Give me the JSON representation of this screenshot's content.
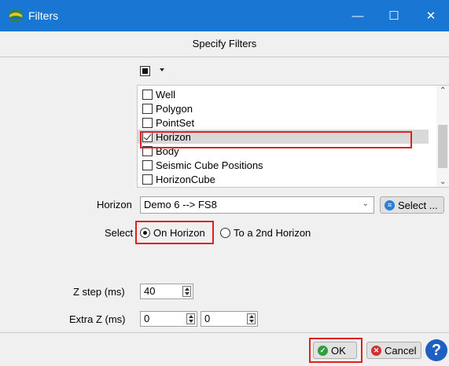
{
  "window": {
    "title": "Filters",
    "icon": "app-logo-icon",
    "controls": {
      "minimize": "—",
      "maximize": "☐",
      "close": "✕"
    }
  },
  "heading": "Specify Filters",
  "select_all": {
    "icon": "select-all-icon"
  },
  "filter_list": {
    "items": [
      {
        "label": "Well",
        "checked": false
      },
      {
        "label": "Polygon",
        "checked": false
      },
      {
        "label": "PointSet",
        "checked": false
      },
      {
        "label": "Horizon",
        "checked": true
      },
      {
        "label": "Body",
        "checked": false
      },
      {
        "label": "Seismic Cube Positions",
        "checked": false
      },
      {
        "label": "HorizonCube",
        "checked": false
      }
    ]
  },
  "horizon": {
    "label": "Horizon",
    "value": "Demo 6 --> FS8",
    "select_button": "Select ..."
  },
  "select_mode": {
    "label": "Select",
    "options": [
      {
        "label": "On Horizon",
        "selected": true
      },
      {
        "label": "To a 2nd Horizon",
        "selected": false
      }
    ]
  },
  "z_step": {
    "label": "Z step (ms)",
    "value": "40"
  },
  "extra_z": {
    "label": "Extra Z (ms)",
    "value_1": "0",
    "value_2": "0"
  },
  "buttons": {
    "ok": "OK",
    "cancel": "Cancel",
    "help": "?"
  },
  "colors": {
    "titlebar": "#1976d2",
    "highlight_box": "#e02020",
    "ok_icon": "#2e9e3e",
    "cancel_icon": "#d03030",
    "select_icon": "#2a7fd6",
    "help": "#1f5fbf"
  }
}
